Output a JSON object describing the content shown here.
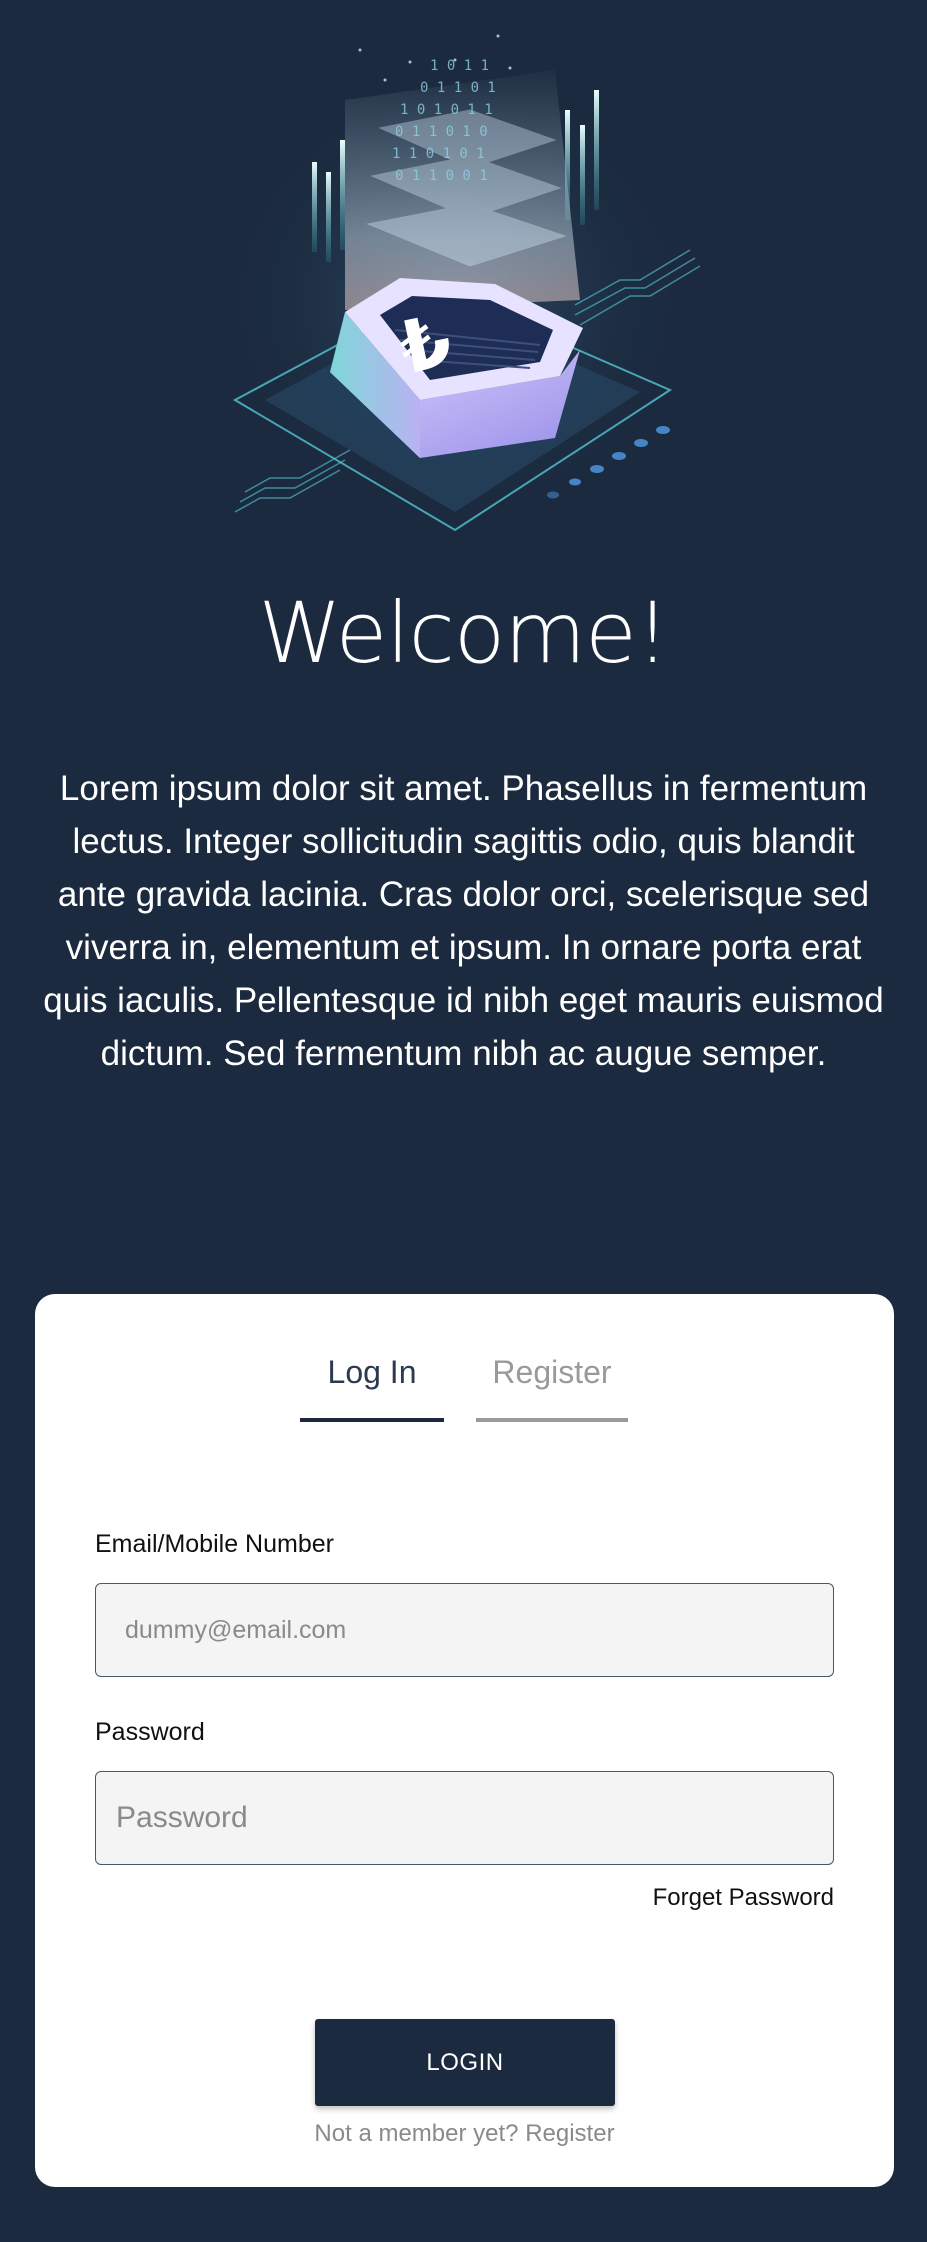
{
  "hero": {
    "icon": "hexagon-coin-illustration",
    "title": "Welcome!",
    "description": "Lorem ipsum dolor sit amet. Phasellus in fermentum lectus. Integer sollicitudin sagittis odio, quis blandit ante gravida lacinia. Cras dolor orci, scelerisque sed viverra in, elementum et ipsum. In ornare porta erat quis iaculis. Pellentesque id nibh eget mauris euismod dictum. Sed fermentum nibh ac augue semper."
  },
  "tabs": [
    {
      "label": "Log In",
      "active": true
    },
    {
      "label": "Register",
      "active": false
    }
  ],
  "form": {
    "email_label": "Email/Mobile Number",
    "email_placeholder": "dummy@email.com",
    "email_value": "",
    "password_label": "Password",
    "password_placeholder": "Password",
    "password_value": "",
    "forget_label": "Forget Password",
    "login_label": "LOGIN",
    "not_member_text": "Not a member yet?",
    "register_link": "Register"
  },
  "colors": {
    "background": "#1b2a3e",
    "card": "#ffffff",
    "accent": "#1b2a3e",
    "inactive_tab": "#9a9a9a"
  }
}
